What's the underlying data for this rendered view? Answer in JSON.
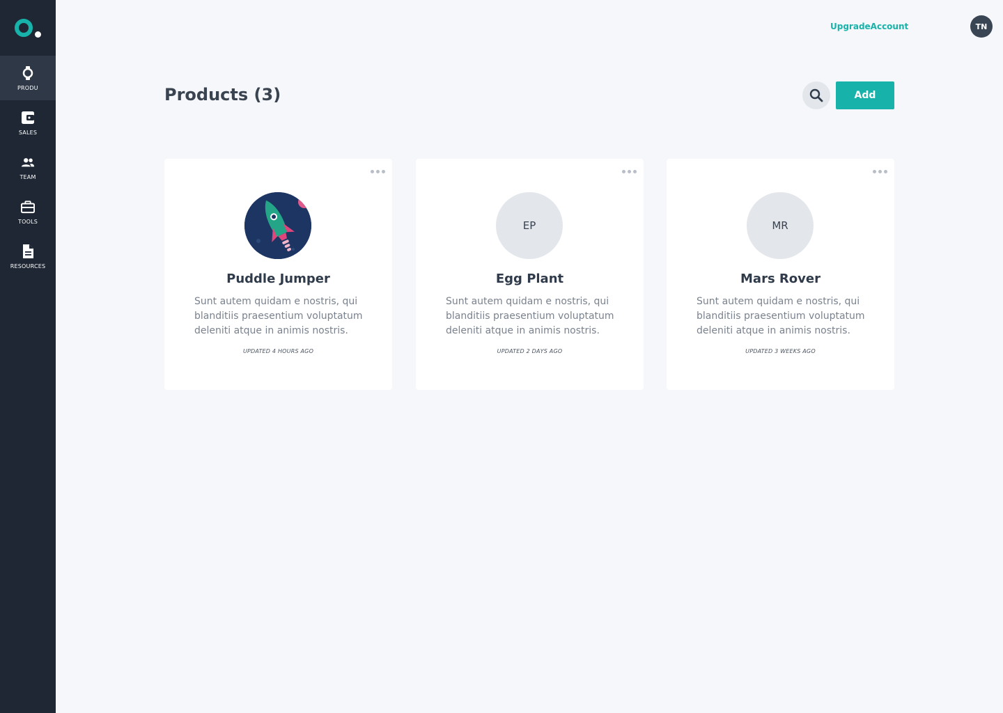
{
  "sidebar": {
    "items": [
      {
        "label": "PRODUC",
        "icon": "watch-icon",
        "active": true
      },
      {
        "label": "SALES",
        "icon": "wallet-icon",
        "active": false
      },
      {
        "label": "TEAM",
        "icon": "people-icon",
        "active": false
      },
      {
        "label": "TOOLS",
        "icon": "briefcase-icon",
        "active": false
      },
      {
        "label": "RESOURCES",
        "icon": "document-icon",
        "active": false
      }
    ]
  },
  "topbar": {
    "upgrade_label": "UpgradeAccount",
    "avatar_initials": "TN"
  },
  "header": {
    "title": "Products (3)",
    "add_label": "Add",
    "search_icon": "search-icon"
  },
  "products": [
    {
      "name": "Puddle Jumper",
      "thumb_type": "image",
      "thumb_text": "",
      "description": "Sunt autem quidam e nostris, qui blanditiis praesentium voluptatum deleniti atque in animis nostris.",
      "updated": "UPDATED 4 HOURS AGO"
    },
    {
      "name": "Egg Plant",
      "thumb_type": "initials",
      "thumb_text": "EP",
      "description": "Sunt autem quidam e nostris, qui blanditiis praesentium voluptatum deleniti atque in animis nostris.",
      "updated": "UPDATED 2 DAYS AGO"
    },
    {
      "name": "Mars Rover",
      "thumb_type": "initials",
      "thumb_text": "MR",
      "description": "Sunt autem quidam e nostris, qui blanditiis praesentium voluptatum deleniti atque in animis nostris.",
      "updated": "UPDATED 3 WEEKS AGO"
    }
  ],
  "colors": {
    "accent": "#17b3aa",
    "sidebar": "#1e2733",
    "background": "#f5f7fa"
  }
}
